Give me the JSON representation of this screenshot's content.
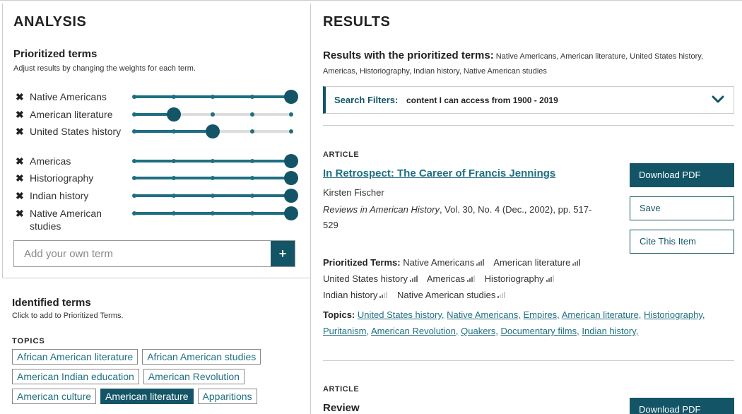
{
  "analysis": {
    "title": "ANALYSIS",
    "prioritized_title": "Prioritized terms",
    "prioritized_subtitle": "Adjust results by changing the weights for each term.",
    "terms": [
      {
        "label": "Native Americans",
        "weight": 5
      },
      {
        "label": "American literature",
        "weight": 2
      },
      {
        "label": "United States history",
        "weight": 3
      },
      {
        "label": "Americas",
        "weight": 5
      },
      {
        "label": "Historiography",
        "weight": 5
      },
      {
        "label": "Indian history",
        "weight": 5
      },
      {
        "label": "Native American studies",
        "weight": 5
      }
    ],
    "remove_glyph": "✖",
    "add_placeholder": "Add your own term",
    "add_button": "+"
  },
  "identified": {
    "title": "Identified terms",
    "subtitle": "Click to add to Prioritized Terms.",
    "topics_label": "TOPICS",
    "rows": [
      [
        {
          "label": "African American literature",
          "active": false
        },
        {
          "label": "African American studies",
          "active": false
        }
      ],
      [
        {
          "label": "American Indian education",
          "active": false
        },
        {
          "label": "American Revolution",
          "active": false
        }
      ],
      [
        {
          "label": "American culture",
          "active": false
        },
        {
          "label": "American literature",
          "active": true
        },
        {
          "label": "Apparitions",
          "active": false
        }
      ]
    ]
  },
  "results": {
    "title": "RESULTS",
    "with_label": "Results with the prioritized terms:",
    "with_terms": "Native Americans, American literature, United States history, Americas, Historiography, Indian history, Native American studies",
    "filters_label": "Search Filters:",
    "filters_value": "content I can access from 1900 - 2019",
    "articles": [
      {
        "type": "ARTICLE",
        "title": "In Retrospect: The Career of Francis Jennings",
        "author": "Kirsten Fischer",
        "journal": "Reviews in American History",
        "cite_rest": ", Vol. 30, No. 4 (Dec., 2002), pp. 517-529",
        "download_label": "Download PDF",
        "save_label": "Save",
        "cite_label": "Cite This Item",
        "pterms_label": "Prioritized Terms:",
        "pterms": [
          {
            "label": "Native Americans",
            "level": 4
          },
          {
            "label": "American literature",
            "level": 4
          },
          {
            "label": "United States history",
            "level": 4
          },
          {
            "label": "Americas",
            "level": 3
          },
          {
            "label": "Historiography",
            "level": 3
          },
          {
            "label": "Indian history",
            "level": 2
          },
          {
            "label": "Native American studies",
            "level": 1
          }
        ],
        "topics_label": "Topics:",
        "topics": [
          "United States history,",
          "Native Americans,",
          "Empires,",
          "American literature,",
          "Historiography,",
          "Puritanism,",
          "American Revolution,",
          "Quakers,",
          "Documentary films,",
          "Indian history,"
        ]
      },
      {
        "type": "ARTICLE",
        "title": "Review",
        "download_label": "Download PDF"
      }
    ]
  }
}
